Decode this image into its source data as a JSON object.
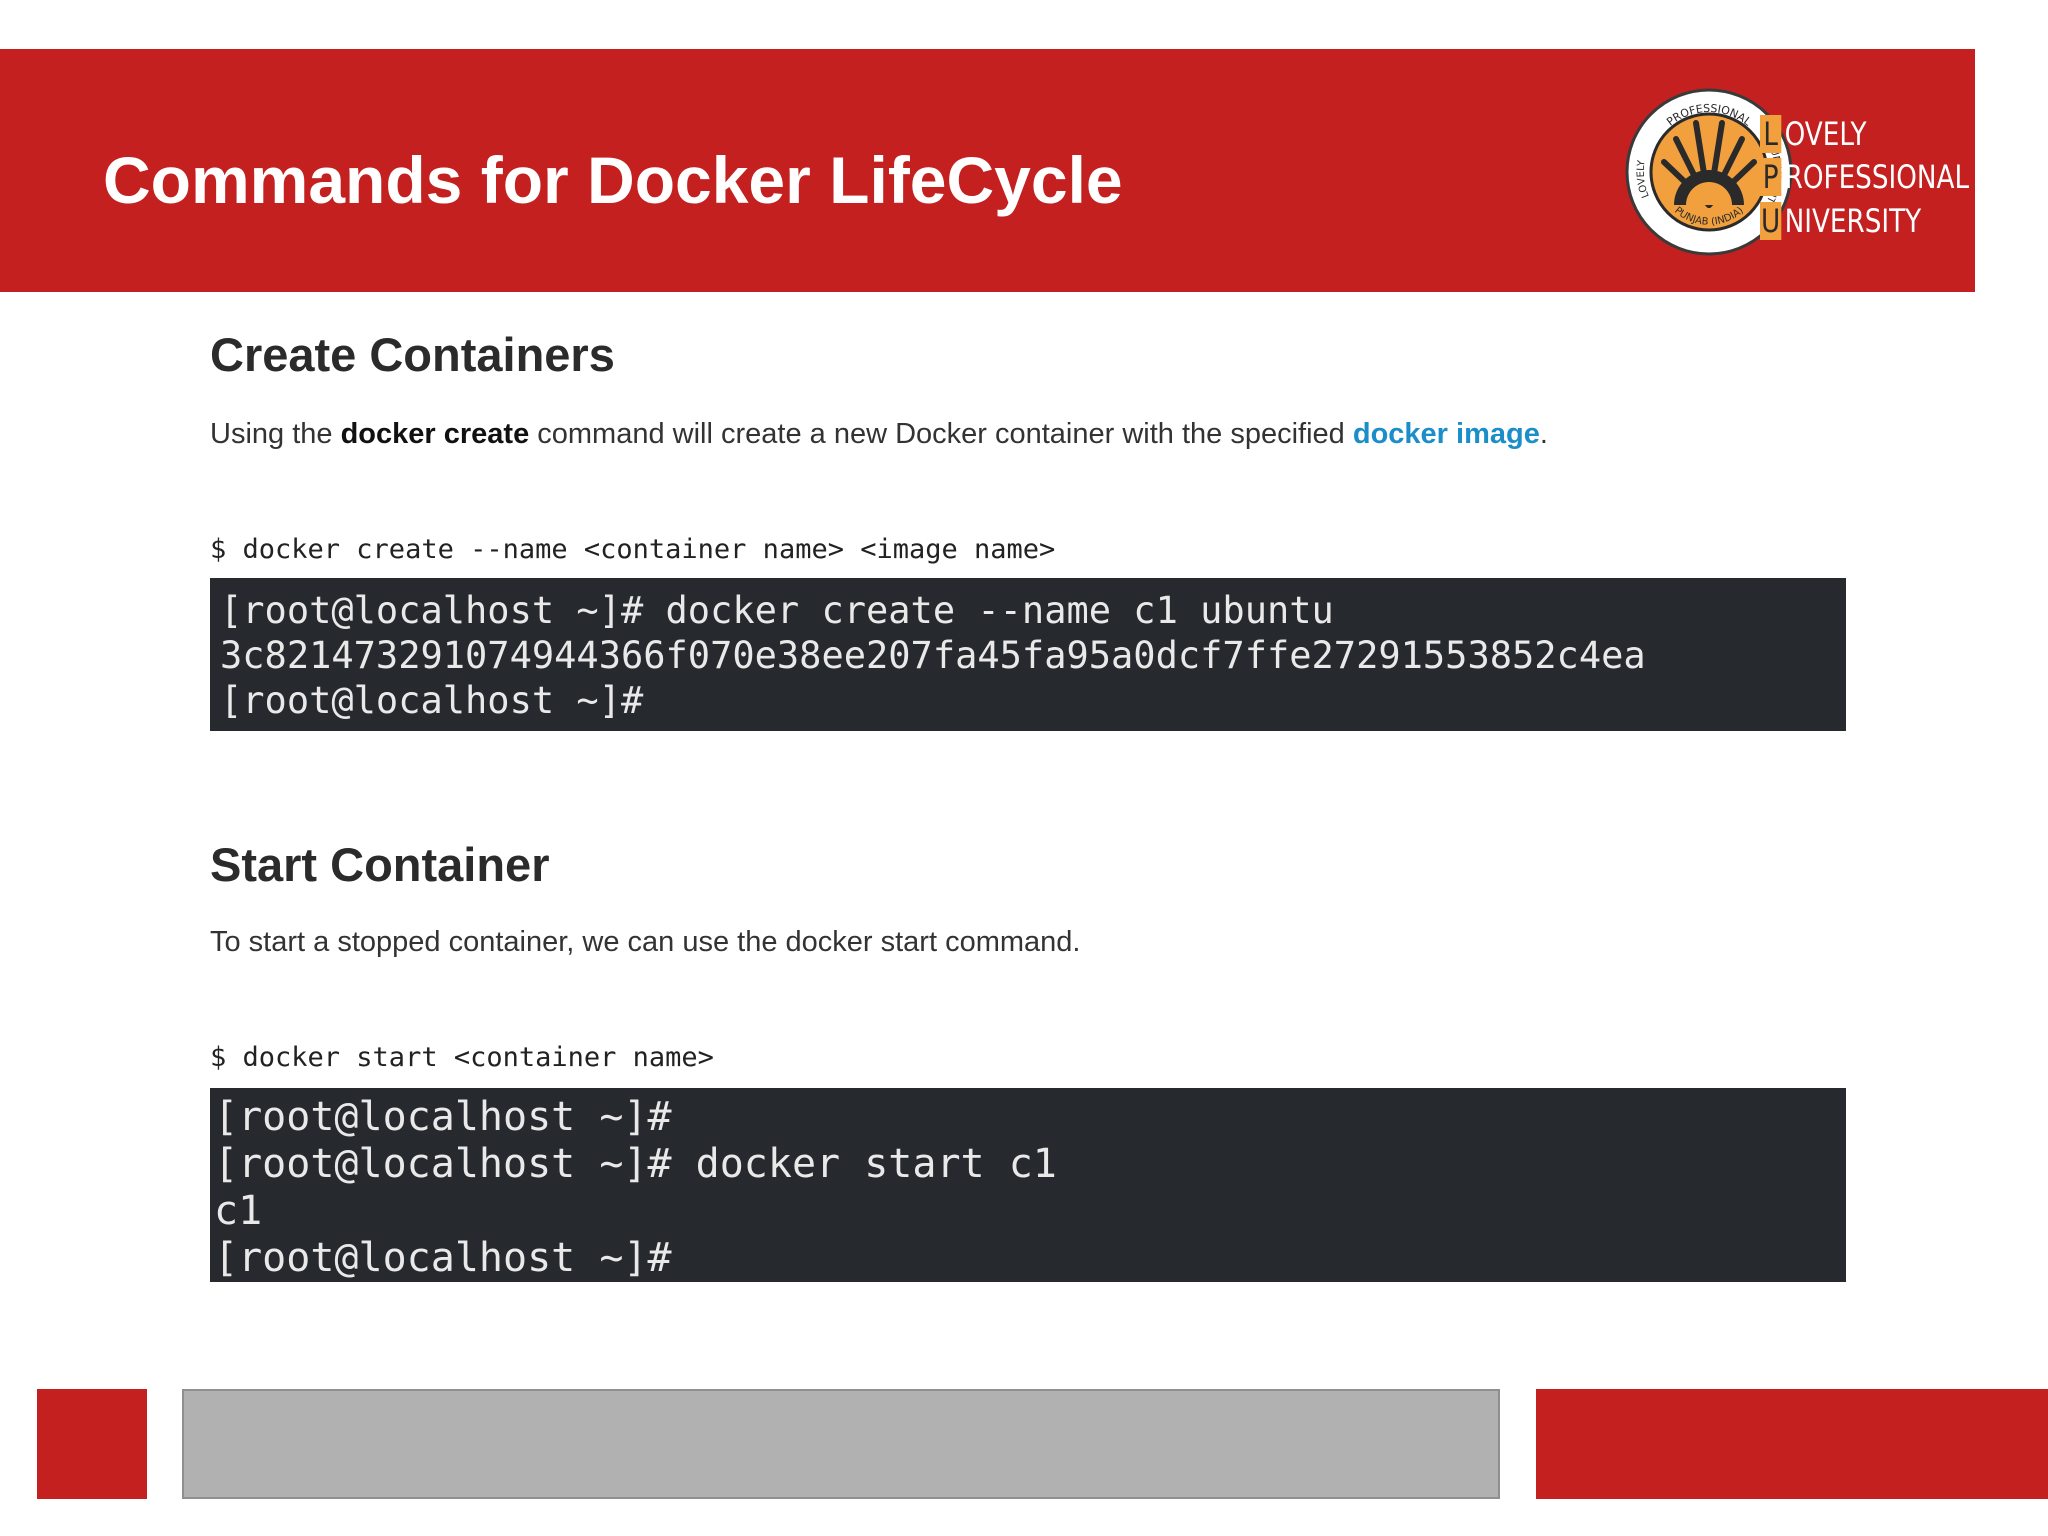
{
  "header": {
    "title": "Commands for Docker LifeCycle",
    "logo": {
      "seal_top_text": "PROFESSIONAL",
      "seal_left_text": "LOVELY",
      "seal_right_text": "UNIVERSITY",
      "seal_bottom_text": "PUNJAB (INDIA)",
      "words": [
        {
          "initial": "L",
          "rest": "OVELY"
        },
        {
          "initial": "P",
          "rest": "ROFESSIONAL"
        },
        {
          "initial": "U",
          "rest": "NIVERSITY"
        }
      ]
    }
  },
  "create": {
    "heading": "Create Containers",
    "desc_prefix": "Using the ",
    "desc_bold": "docker create",
    "desc_middle": " command will create a new Docker container with the specified ",
    "desc_link": "docker image",
    "desc_suffix": ".",
    "syntax": "$ docker create --name <container name> <image name>",
    "terminal": [
      "[root@localhost ~]# docker create --name c1 ubuntu",
      "3c821473291074944366f070e38ee207fa45fa95a0dcf7ffe27291553852c4ea",
      "[root@localhost ~]#"
    ]
  },
  "start": {
    "heading": "Start Container",
    "desc": "To start a stopped container, we can use the docker start command.",
    "syntax": "$ docker start <container name>",
    "terminal": [
      "[root@localhost ~]#",
      "[root@localhost ~]# docker start c1",
      "c1",
      "[root@localhost ~]#"
    ]
  },
  "colors": {
    "brand_red": "#c4201f",
    "logo_orange": "#f2a03d",
    "terminal_bg": "#262a2e",
    "link_blue": "#1b8ec9",
    "footer_gray": "#b1b1b1"
  }
}
